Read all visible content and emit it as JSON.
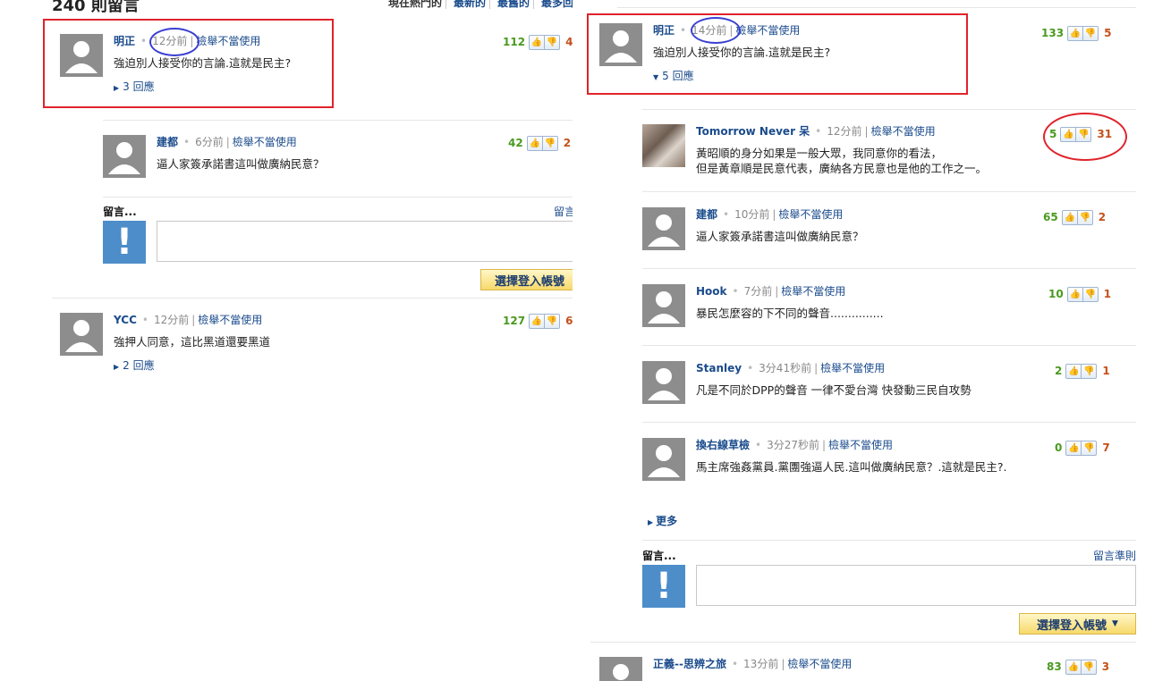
{
  "left": {
    "header_title": "240 則留言",
    "sort_tabs": [
      "現在熱門的",
      "最新的",
      "最舊的",
      "最多回應"
    ],
    "comments": [
      {
        "author": "明正",
        "time": "12分前",
        "report": "檢舉不當使用",
        "text": "強迫別人接受你的言論.這就是民主?",
        "replies": "3 回應",
        "up": "112",
        "down": "4"
      },
      {
        "author": "建都",
        "time": "6分前",
        "report": "檢舉不當使用",
        "text": "逼人家簽承諾書這叫做廣納民意？",
        "up": "42",
        "down": "2"
      },
      {
        "author": "YCC",
        "time": "12分前",
        "report": "檢舉不當使用",
        "text": "強押人同意，這比黑道還要黑道",
        "replies": "2 回應",
        "up": "127",
        "down": "6"
      }
    ],
    "reply_box": {
      "label": "留言...",
      "rules": "留言",
      "login": "選擇登入帳號"
    }
  },
  "right": {
    "comments": [
      {
        "author": "明正",
        "time": "14分前",
        "report": "檢舉不當使用",
        "text": "強迫別人接受你的言論.這就是民主?",
        "replies": "5 回應",
        "up": "133",
        "down": "5"
      },
      {
        "author": "Tomorrow Never 呆",
        "time": "12分前",
        "report": "檢舉不當使用",
        "text": "黃昭順的身分如果是一般大眾，我同意你的看法，",
        "text2": "但是黃章順是民意代表，廣納各方民意也是他的工作之一。",
        "up": "5",
        "down": "31"
      },
      {
        "author": "建都",
        "time": "10分前",
        "report": "檢舉不當使用",
        "text": "逼人家簽承諾書這叫做廣納民意？",
        "up": "65",
        "down": "2"
      },
      {
        "author": "Hook",
        "time": "7分前",
        "report": "檢舉不當使用",
        "text": "暴民怎麼容的下不同的聲音...............",
        "up": "10",
        "down": "1"
      },
      {
        "author": "Stanley",
        "time": "3分41秒前",
        "report": "檢舉不當使用",
        "text": "凡是不同於DPP的聲音 一律不愛台灣 快發動三民自攻勢",
        "up": "2",
        "down": "1"
      },
      {
        "author": "換右線草檢",
        "time": "3分27秒前",
        "report": "檢舉不當使用",
        "text": "馬主席強姦黨員.黨團強逼人民.這叫做廣納民意？.這就是民主?.",
        "up": "0",
        "down": "7"
      },
      {
        "author": "正義--思辨之旅",
        "time": "13分前",
        "report": "檢舉不當使用",
        "up": "83",
        "down": "3"
      }
    ],
    "more": "更多",
    "reply_box": {
      "label": "留言...",
      "rules": "留言準則",
      "login": "選擇登入帳號"
    }
  },
  "colors": {
    "annotation_red": "#e0232b",
    "annotation_blue": "#3a3fd2",
    "link": "#1a4b8c",
    "up": "#4a9a1e",
    "down": "#c4501a"
  }
}
